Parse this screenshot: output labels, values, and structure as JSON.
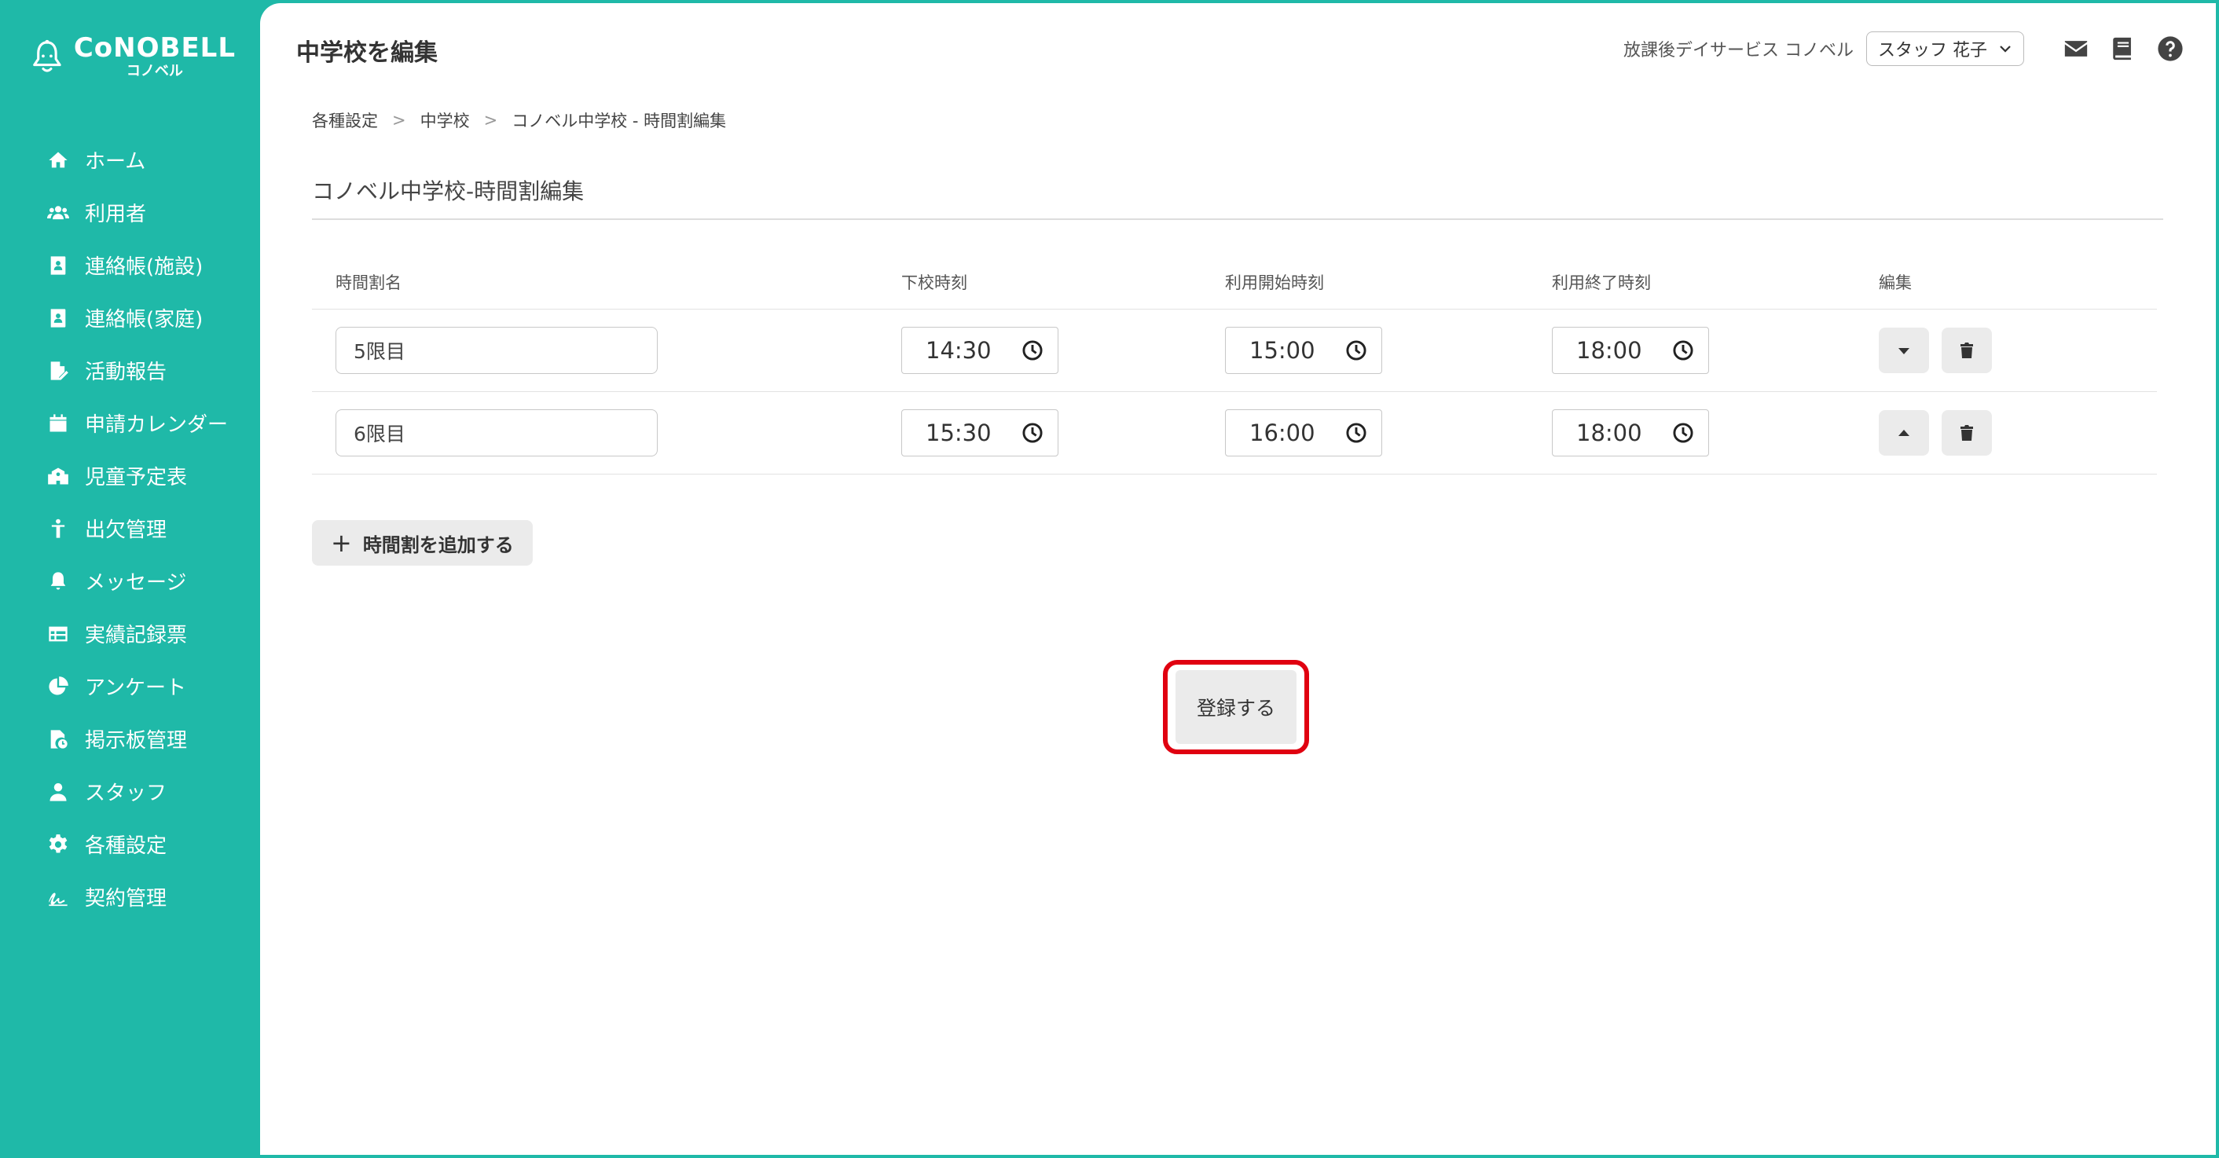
{
  "app": {
    "logo_text": "CoNOBELL",
    "logo_sub": "コノベル"
  },
  "sidebar": {
    "items": [
      {
        "label": "ホーム",
        "icon": "home-icon"
      },
      {
        "label": "利用者",
        "icon": "users-icon"
      },
      {
        "label": "連絡帳(施設)",
        "icon": "contact-book-icon"
      },
      {
        "label": "連絡帳(家庭)",
        "icon": "contact-book-icon"
      },
      {
        "label": "活動報告",
        "icon": "file-edit-icon"
      },
      {
        "label": "申請カレンダー",
        "icon": "calendar-icon"
      },
      {
        "label": "児童予定表",
        "icon": "school-icon"
      },
      {
        "label": "出欠管理",
        "icon": "child-icon"
      },
      {
        "label": "メッセージ",
        "icon": "bell-icon"
      },
      {
        "label": "実績記録票",
        "icon": "table-icon"
      },
      {
        "label": "アンケート",
        "icon": "pie-chart-icon"
      },
      {
        "label": "掲示板管理",
        "icon": "file-clock-icon"
      },
      {
        "label": "スタッフ",
        "icon": "person-icon"
      },
      {
        "label": "各種設定",
        "icon": "gear-icon"
      },
      {
        "label": "契約管理",
        "icon": "signature-icon"
      }
    ]
  },
  "header": {
    "title": "中学校を編集",
    "facility": "放課後デイサービス コノベル",
    "staff": "スタッフ 花子"
  },
  "breadcrumb": [
    "各種設定",
    "中学校",
    "コノベル中学校 - 時間割編集"
  ],
  "section": {
    "title": "コノベル中学校-時間割編集"
  },
  "table": {
    "headers": [
      "時間割名",
      "下校時刻",
      "利用開始時刻",
      "利用終了時刻",
      "編集"
    ],
    "rows": [
      {
        "name": "5限目",
        "dismissal": "14:30",
        "start": "15:00",
        "end": "18:00",
        "move": "down"
      },
      {
        "name": "6限目",
        "dismissal": "15:30",
        "start": "16:00",
        "end": "18:00",
        "move": "up"
      }
    ]
  },
  "actions": {
    "add_label": "時間割を追加する",
    "submit_label": "登録する"
  },
  "colors": {
    "brand": "#1fb9a8",
    "highlight": "#e00010"
  }
}
